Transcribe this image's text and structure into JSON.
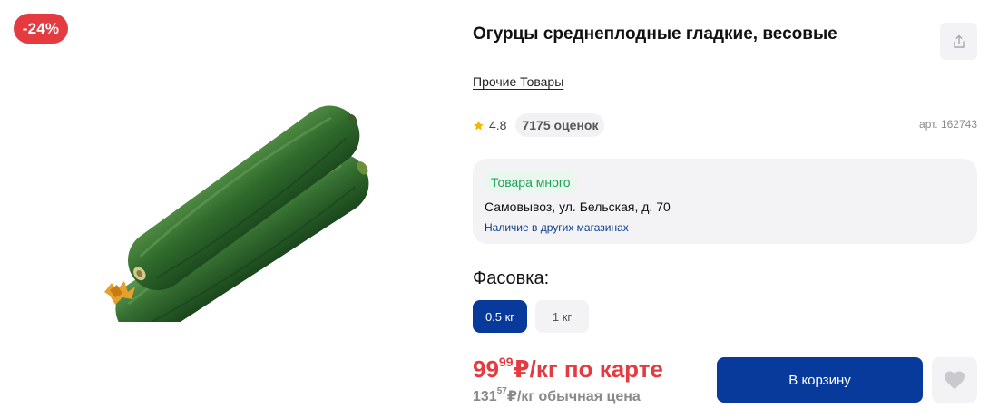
{
  "badge": {
    "discount": "-24%"
  },
  "product": {
    "title": "Огурцы среднеплодные гладкие, весовые",
    "image_icon": "cucumber-image",
    "category": "Прочие Товары",
    "rating": "4.8",
    "reviews": "7175 оценок",
    "article": "арт. 162743"
  },
  "share": {
    "icon": "share-icon"
  },
  "stock": {
    "badge": "Товара много",
    "pickup": "Самовывоз, ул. Бельская, д. 70",
    "other_stores": "Наличие в других магазинах"
  },
  "packaging": {
    "label": "Фасовка:",
    "options": [
      {
        "label": "0.5 кг",
        "selected": true
      },
      {
        "label": "1 кг",
        "selected": false
      }
    ]
  },
  "price": {
    "card": {
      "integer": "99",
      "kopecks": "99",
      "suffix": "₽/кг по карте"
    },
    "regular": {
      "integer": "131",
      "kopecks": "57",
      "suffix": "₽/кг обычная цена"
    }
  },
  "actions": {
    "add_to_cart": "В корзину",
    "favorite_icon": "heart-icon"
  },
  "colors": {
    "accent_blue": "#083a9c",
    "discount_red": "#e53a3f",
    "stock_green": "#1fa05a",
    "star_yellow": "#f5b400"
  }
}
